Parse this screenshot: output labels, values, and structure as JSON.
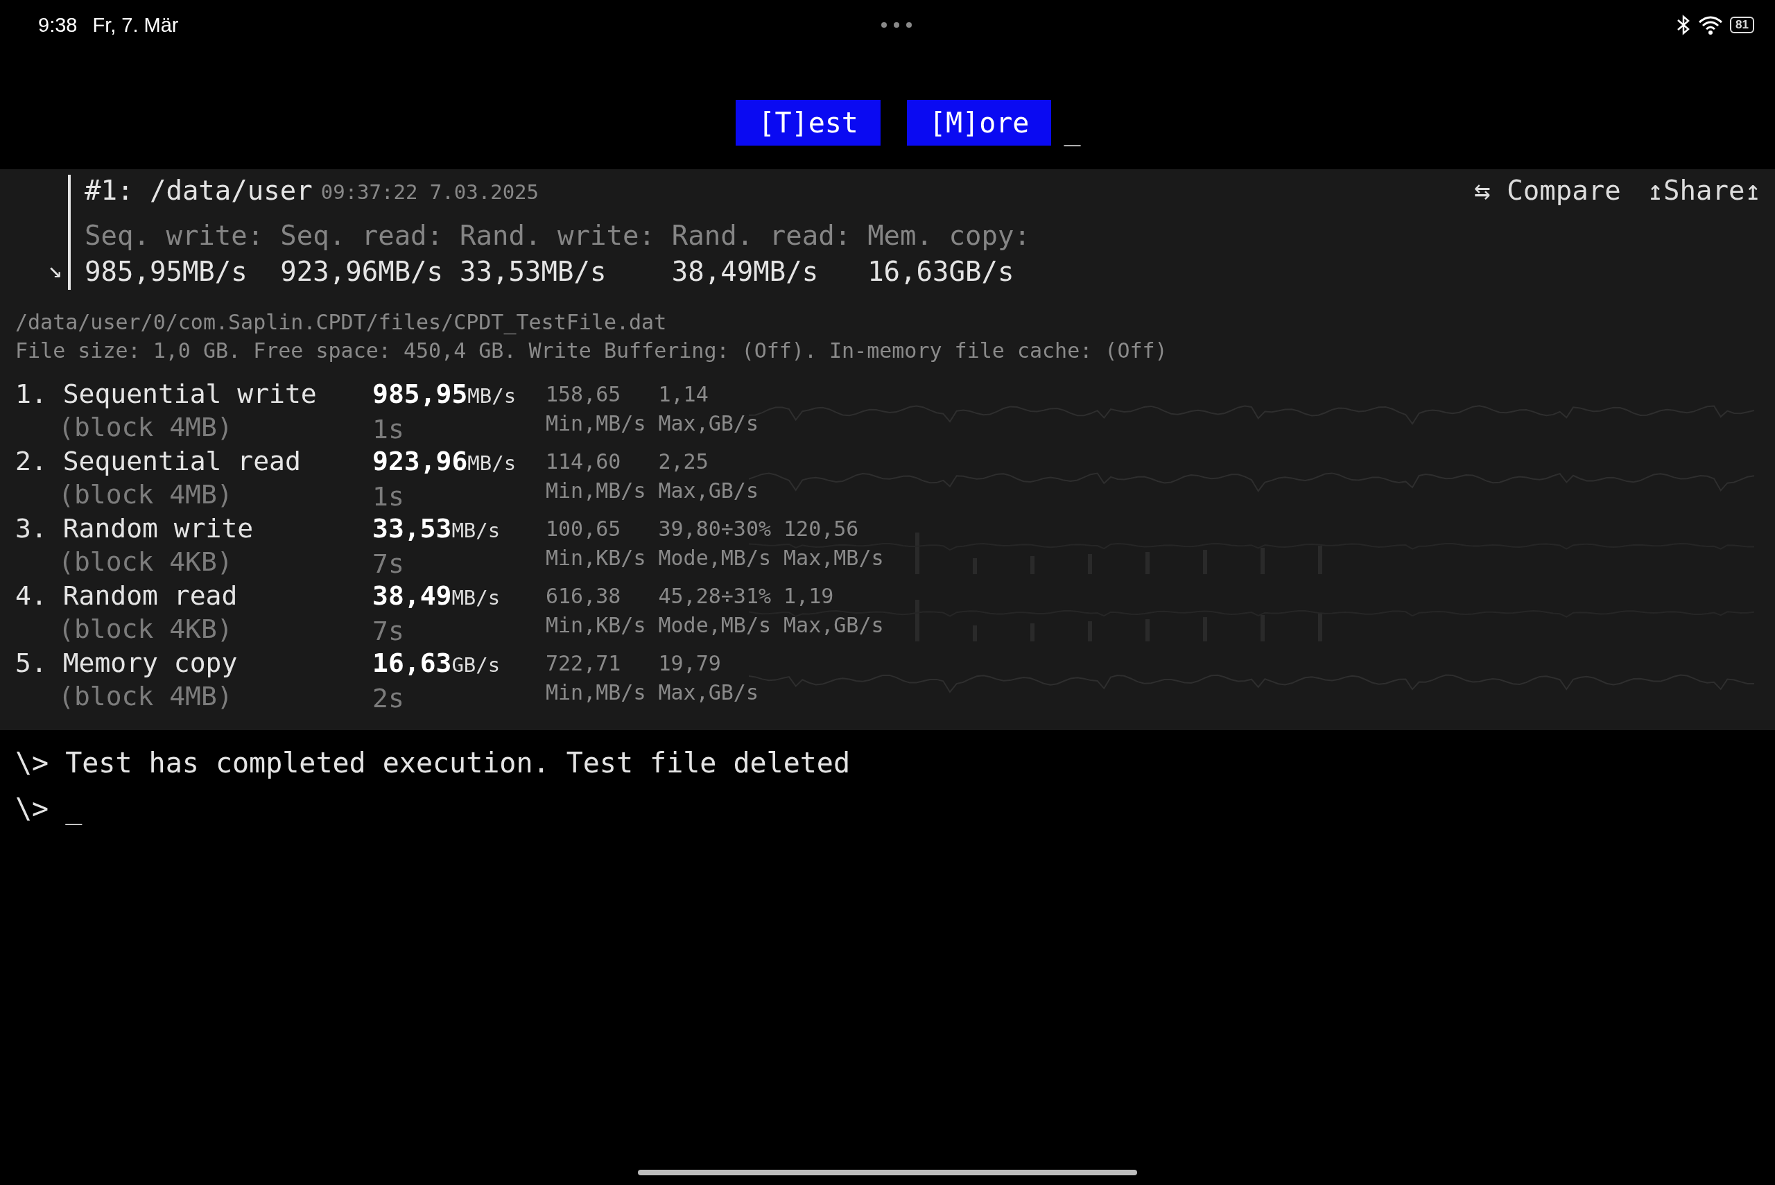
{
  "status_bar": {
    "time": "9:38",
    "date": "Fr, 7. Mär",
    "battery": "81"
  },
  "toolbar": {
    "buttons": [
      {
        "label": "[T]est"
      },
      {
        "label": "[M]ore"
      }
    ],
    "cursor": "_"
  },
  "result": {
    "expand": "↘",
    "title": "#1: /data/user",
    "timestamp": "09:37:22 7.03.2025",
    "actions": [
      {
        "label": "⇆ Compare"
      },
      {
        "label": "↥Share↥"
      }
    ],
    "summary": [
      {
        "label": "Seq. write:",
        "value": "985,95MB/s"
      },
      {
        "label": "Seq. read:",
        "value": "923,96MB/s"
      },
      {
        "label": "Rand. write:",
        "value": "33,53MB/s"
      },
      {
        "label": "Rand. read:",
        "value": "38,49MB/s"
      },
      {
        "label": "Mem. copy:",
        "value": "16,63GB/s"
      }
    ],
    "file_path": "/data/user/0/com.Saplin.CPDT/files/CPDT_TestFile.dat",
    "file_info": "File size: 1,0 GB. Free space: 450,4 GB. Write Buffering: (Off). In-memory file cache: (Off)",
    "tests": [
      {
        "number": "1.",
        "name": "Sequential write",
        "block": "(block 4MB)",
        "value": "985,95",
        "unit": "MB/s",
        "duration": "1s",
        "kind": "line",
        "stats": [
          {
            "value": "158,65",
            "label": "Min,MB/s"
          },
          {
            "value": "1,14",
            "label": "Max,GB/s"
          }
        ]
      },
      {
        "number": "2.",
        "name": "Sequential read",
        "block": "(block 4MB)",
        "value": "923,96",
        "unit": "MB/s",
        "duration": "1s",
        "kind": "line",
        "stats": [
          {
            "value": "114,60",
            "label": "Min,MB/s"
          },
          {
            "value": "2,25",
            "label": "Max,GB/s"
          }
        ]
      },
      {
        "number": "3.",
        "name": "Random write",
        "block": "(block 4KB)",
        "value": "33,53",
        "unit": "MB/s",
        "duration": "7s",
        "kind": "spikes",
        "stats": [
          {
            "value": "100,65",
            "label": "Min,KB/s"
          },
          {
            "value": "39,80÷30%",
            "label": "Mode,MB/s"
          },
          {
            "value": "120,56",
            "label": "Max,MB/s"
          }
        ]
      },
      {
        "number": "4.",
        "name": "Random read",
        "block": "(block 4KB)",
        "value": "38,49",
        "unit": "MB/s",
        "duration": "7s",
        "kind": "spikes",
        "stats": [
          {
            "value": "616,38",
            "label": "Min,KB/s"
          },
          {
            "value": "45,28÷31%",
            "label": "Mode,MB/s"
          },
          {
            "value": "1,19",
            "label": "Max,GB/s"
          }
        ]
      },
      {
        "number": "5.",
        "name": "Memory copy",
        "block": "(block 4MB)",
        "value": "16,63",
        "unit": "GB/s",
        "duration": "2s",
        "kind": "line",
        "stats": [
          {
            "value": "722,71",
            "label": "Min,MB/s"
          },
          {
            "value": "19,79",
            "label": "Max,GB/s"
          }
        ]
      }
    ]
  },
  "console": [
    {
      "prompt": "\\>",
      "text": "Test has completed execution. Test file deleted"
    },
    {
      "prompt": "\\>",
      "text": "_"
    }
  ]
}
